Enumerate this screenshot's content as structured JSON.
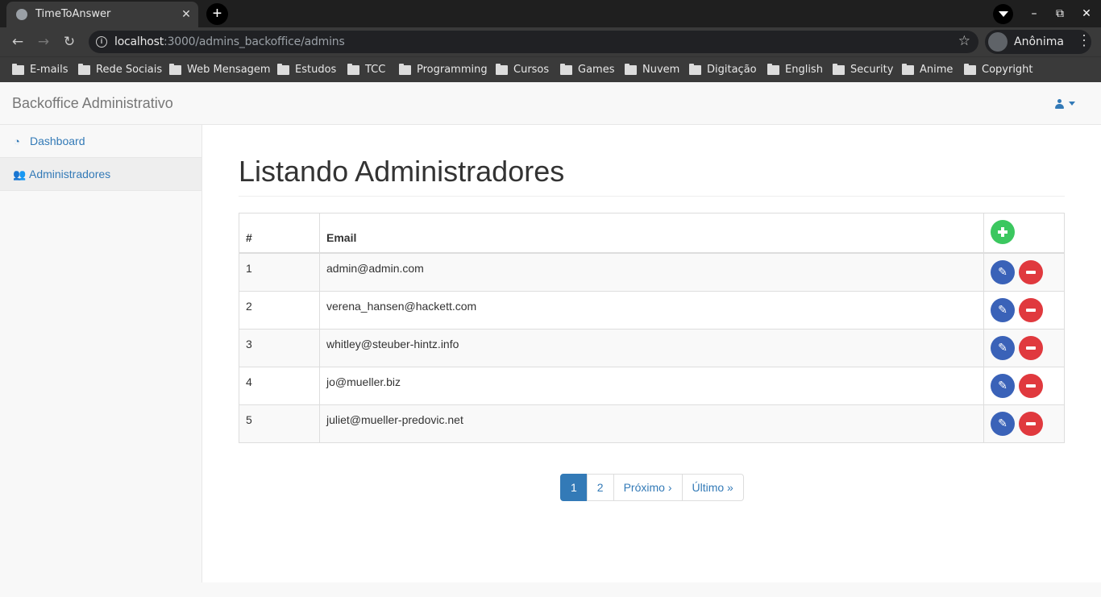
{
  "browser": {
    "tab_title": "TimeToAnswer",
    "tab_close": "✕",
    "new_tab": "+",
    "url_host": "localhost",
    "url_path": ":3000/admins_backoffice/admins",
    "profile_label": "Anônima",
    "bookmarks": [
      "E-mails",
      "Rede Sociais",
      "Web Mensagem",
      "Estudos",
      "TCC",
      "Programming",
      "Cursos",
      "Games",
      "Nuvem",
      "Digitação",
      "English",
      "Security",
      "Anime",
      "Copyright"
    ]
  },
  "app": {
    "brand": "Backoffice Administrativo",
    "sidebar": [
      {
        "label": "Dashboard",
        "icon": "dashboard-icon"
      },
      {
        "label": "Administradores",
        "icon": "users-icon"
      }
    ],
    "page_title": "Listando Administradores",
    "table": {
      "headers": [
        "#",
        "Email"
      ],
      "rows": [
        {
          "id": "1",
          "email": "admin@admin.com"
        },
        {
          "id": "2",
          "email": "verena_hansen@hackett.com"
        },
        {
          "id": "3",
          "email": "whitley@steuber-hintz.info"
        },
        {
          "id": "4",
          "email": "jo@mueller.biz"
        },
        {
          "id": "5",
          "email": "juliet@mueller-predovic.net"
        }
      ]
    },
    "pagination": [
      "1",
      "2",
      "Próximo ›",
      "Último »"
    ],
    "colors": {
      "add": "#3bc75f",
      "edit": "#3a62b8",
      "delete": "#e0393e",
      "link": "#337ab7"
    }
  }
}
